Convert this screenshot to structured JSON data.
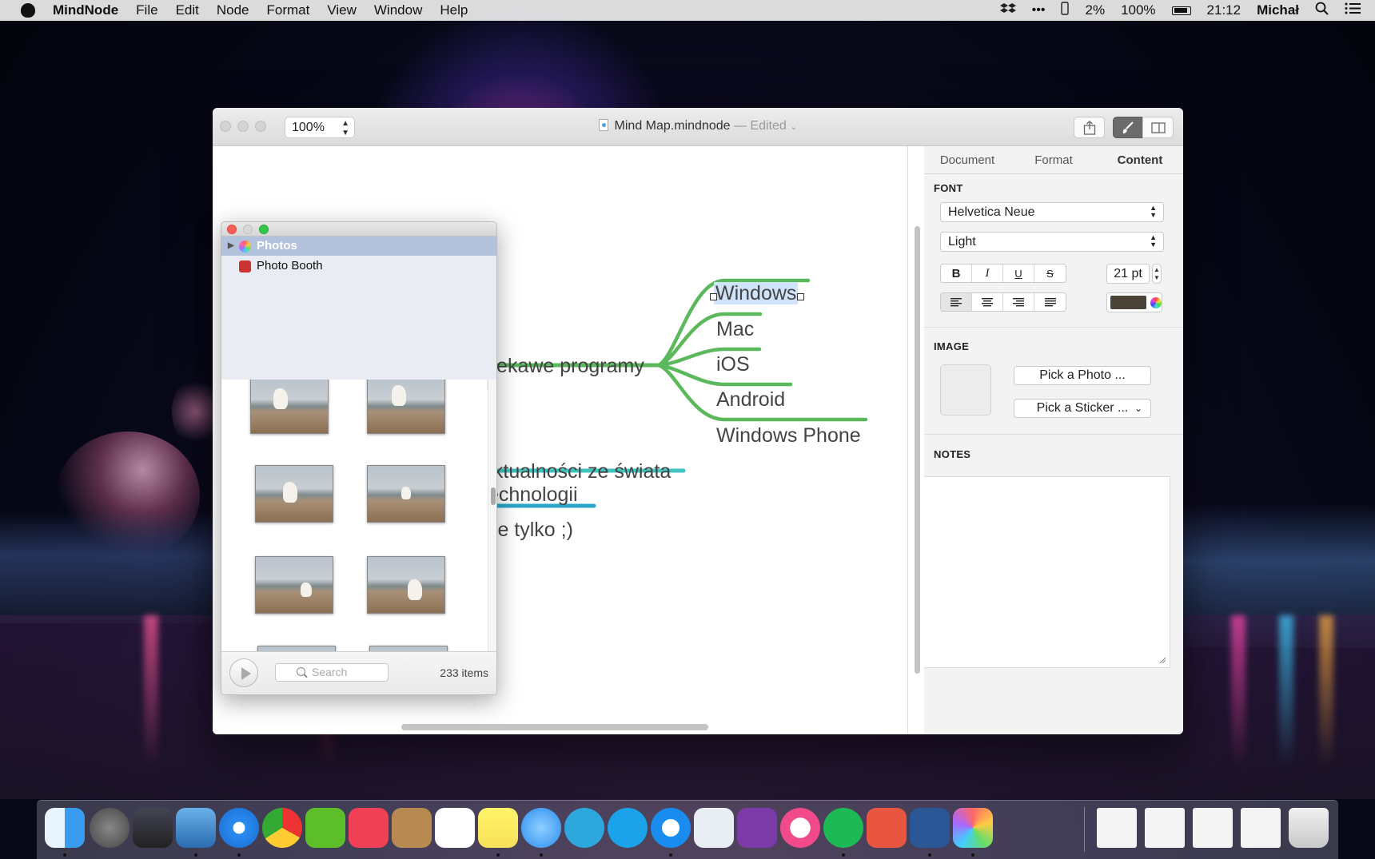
{
  "menubar": {
    "app_name": "MindNode",
    "menus": [
      "File",
      "Edit",
      "Node",
      "Format",
      "View",
      "Window",
      "Help"
    ],
    "status": {
      "cpu": "2%",
      "battery": "100%",
      "time": "21:12",
      "user": "Michał"
    }
  },
  "window": {
    "title": "Mind Map.mindnode",
    "edited": "— Edited",
    "zoom": "100%"
  },
  "mindmap": {
    "root_branch": "ciekawe programy",
    "children": [
      "Windows",
      "Mac",
      "iOS",
      "Android",
      "Windows Phone"
    ],
    "other_branch_line1": "aktualności ze świata",
    "other_branch_line2": "technologii",
    "third_branch": "nie tylko ;)",
    "colors": {
      "green": "#5cb85c",
      "teal": "#40c4c0",
      "blue": "#2aa6c8"
    }
  },
  "inspector": {
    "tabs": [
      "Document",
      "Format",
      "Content"
    ],
    "active_tab": "Content",
    "font_title": "FONT",
    "font_family": "Helvetica Neue",
    "font_weight": "Light",
    "style_buttons": [
      "B",
      "I",
      "U",
      "S"
    ],
    "font_size": "21 pt",
    "text_color": "#4a4438",
    "image_title": "IMAGE",
    "pick_photo": "Pick a Photo ...",
    "pick_sticker": "Pick a Sticker ...",
    "notes_title": "NOTES"
  },
  "media_browser": {
    "sources": [
      "Photos",
      "Photo Booth"
    ],
    "selected_source": "Photos",
    "search_placeholder": "Search",
    "item_count": "233 items"
  }
}
